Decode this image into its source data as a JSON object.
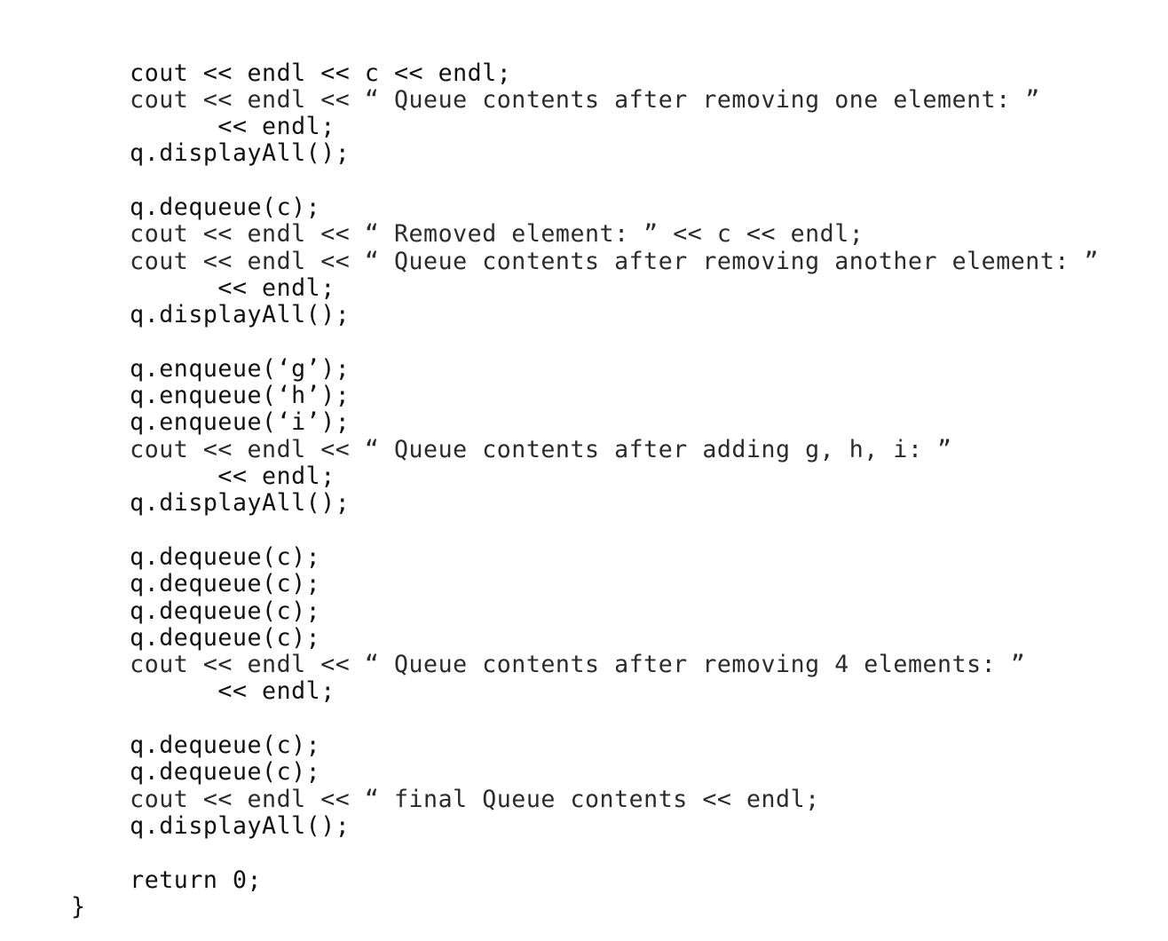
{
  "document": {
    "kind": "code-listing",
    "language": "C++",
    "background_color": "#ffffff",
    "text_color": "#1a1a1a"
  },
  "code": {
    "indent_unit": "    ",
    "lines": [
      {
        "id": "l01",
        "text": "    cout << endl << c << endl;",
        "tone": "dark"
      },
      {
        "id": "l02",
        "text": "    cout << endl << “ Queue contents after removing one element: ”",
        "tone": "light"
      },
      {
        "id": "l03",
        "text": "          << endl;",
        "tone": "dark"
      },
      {
        "id": "l04",
        "text": "    q.displayAll();",
        "tone": "dark"
      },
      {
        "id": "l05",
        "text": "",
        "tone": "dark"
      },
      {
        "id": "l06",
        "text": "    q.dequeue(c);",
        "tone": "dark"
      },
      {
        "id": "l07",
        "text": "    cout << endl << “ Removed element: ” << c << endl;",
        "tone": "light"
      },
      {
        "id": "l08",
        "text": "    cout << endl << “ Queue contents after removing another element: ”",
        "tone": "light"
      },
      {
        "id": "l09",
        "text": "          << endl;",
        "tone": "dark"
      },
      {
        "id": "l10",
        "text": "    q.displayAll();",
        "tone": "dark"
      },
      {
        "id": "l11",
        "text": "",
        "tone": "dark"
      },
      {
        "id": "l12",
        "text": "    q.enqueue(‘g’);",
        "tone": "dark"
      },
      {
        "id": "l13",
        "text": "    q.enqueue(‘h’);",
        "tone": "dark"
      },
      {
        "id": "l14",
        "text": "    q.enqueue(‘i’);",
        "tone": "dark"
      },
      {
        "id": "l15",
        "text": "    cout << endl << “ Queue contents after adding g, h, i: ”",
        "tone": "light"
      },
      {
        "id": "l16",
        "text": "          << endl;",
        "tone": "dark"
      },
      {
        "id": "l17",
        "text": "    q.displayAll();",
        "tone": "dark"
      },
      {
        "id": "l18",
        "text": "",
        "tone": "dark"
      },
      {
        "id": "l19",
        "text": "    q.dequeue(c);",
        "tone": "dark"
      },
      {
        "id": "l20",
        "text": "    q.dequeue(c);",
        "tone": "dark"
      },
      {
        "id": "l21",
        "text": "    q.dequeue(c);",
        "tone": "dark"
      },
      {
        "id": "l22",
        "text": "    q.dequeue(c);",
        "tone": "dark"
      },
      {
        "id": "l23",
        "text": "    cout << endl << “ Queue contents after removing 4 elements: ”",
        "tone": "light"
      },
      {
        "id": "l24",
        "text": "          << endl;",
        "tone": "dark"
      },
      {
        "id": "l25",
        "text": "",
        "tone": "dark"
      },
      {
        "id": "l26",
        "text": "    q.dequeue(c);",
        "tone": "dark"
      },
      {
        "id": "l27",
        "text": "    q.dequeue(c);",
        "tone": "dark"
      },
      {
        "id": "l28",
        "text": "    cout << endl << “ final Queue contents << endl;",
        "tone": "light"
      },
      {
        "id": "l29",
        "text": "    q.displayAll();",
        "tone": "dark"
      },
      {
        "id": "l30",
        "text": "",
        "tone": "dark"
      },
      {
        "id": "l31",
        "text": "    return 0;",
        "tone": "dark"
      },
      {
        "id": "l32",
        "text": "}",
        "tone": "dark"
      }
    ]
  }
}
